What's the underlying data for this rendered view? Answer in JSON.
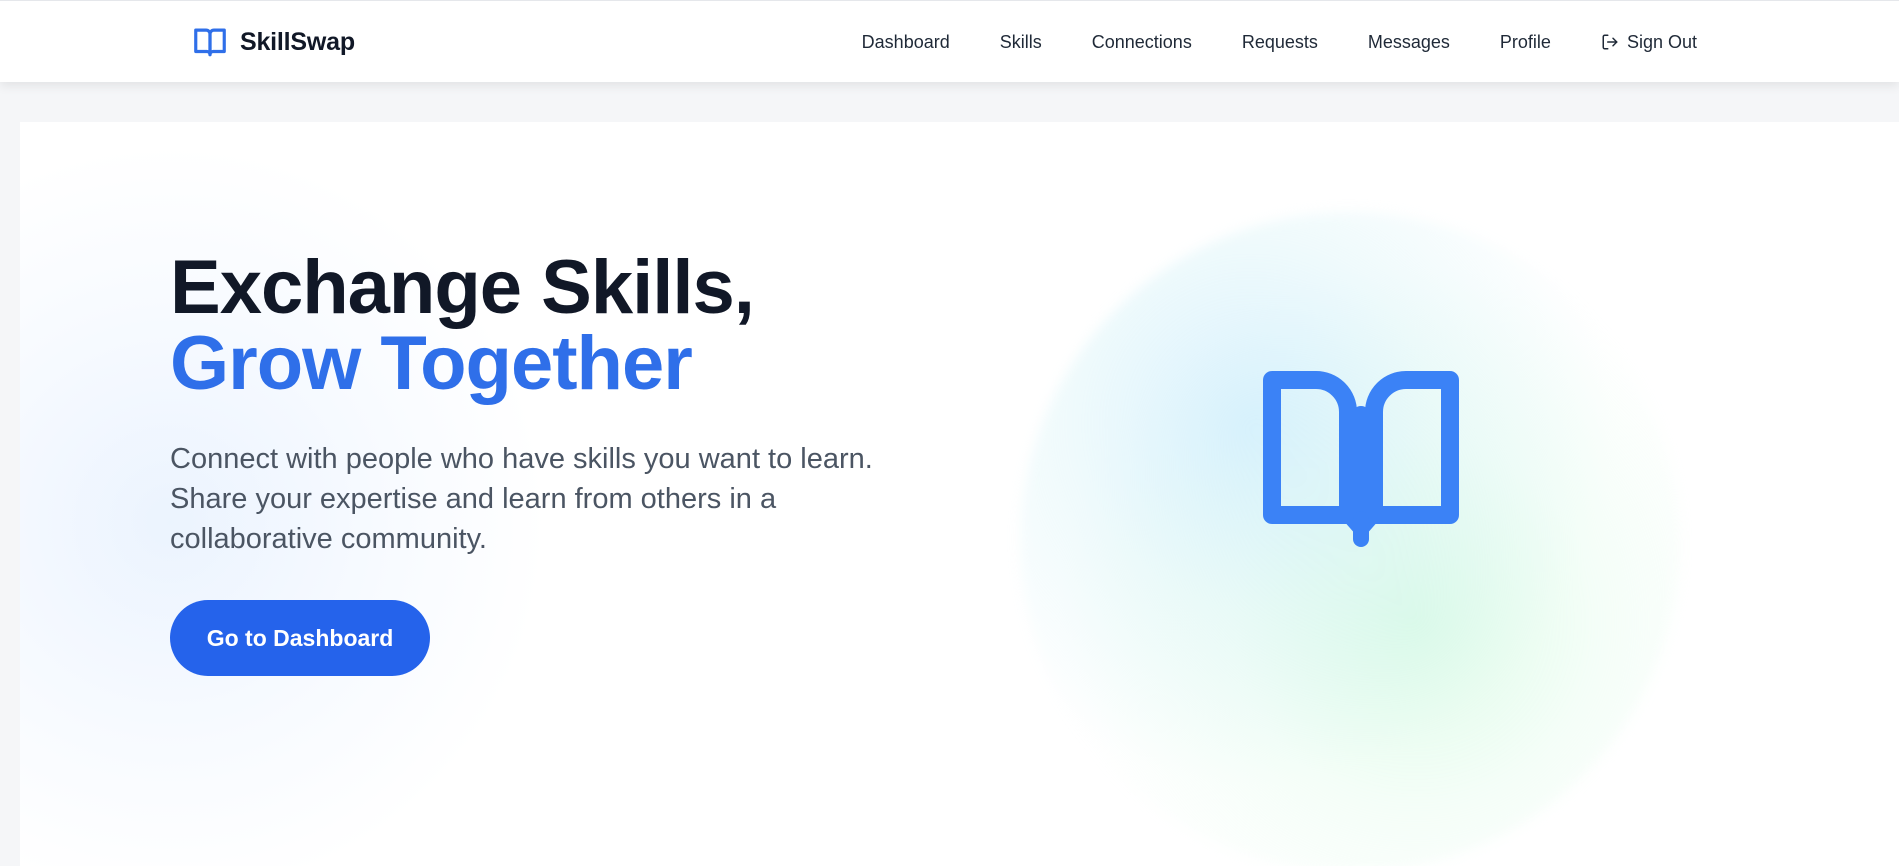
{
  "brand": {
    "name": "SkillSwap",
    "icon": "book-open-icon",
    "color": "#2f6fe9"
  },
  "nav": {
    "items": [
      {
        "label": "Dashboard"
      },
      {
        "label": "Skills"
      },
      {
        "label": "Connections"
      },
      {
        "label": "Requests"
      },
      {
        "label": "Messages"
      },
      {
        "label": "Profile"
      }
    ],
    "signout": {
      "label": "Sign Out",
      "icon": "sign-out-icon"
    }
  },
  "hero": {
    "headline_line1": "Exchange Skills,",
    "headline_line2": "Grow Together",
    "description": "Connect with people who have skills you want to learn. Share your expertise and learn from others in a collaborative community.",
    "cta_label": "Go to Dashboard",
    "illustration_icon": "book-open-icon"
  },
  "colors": {
    "accent": "#2563eb",
    "heading": "#111827",
    "highlight": "#2f6fe9",
    "body_text": "#4b5563",
    "icon_blue": "#3b82f6"
  }
}
